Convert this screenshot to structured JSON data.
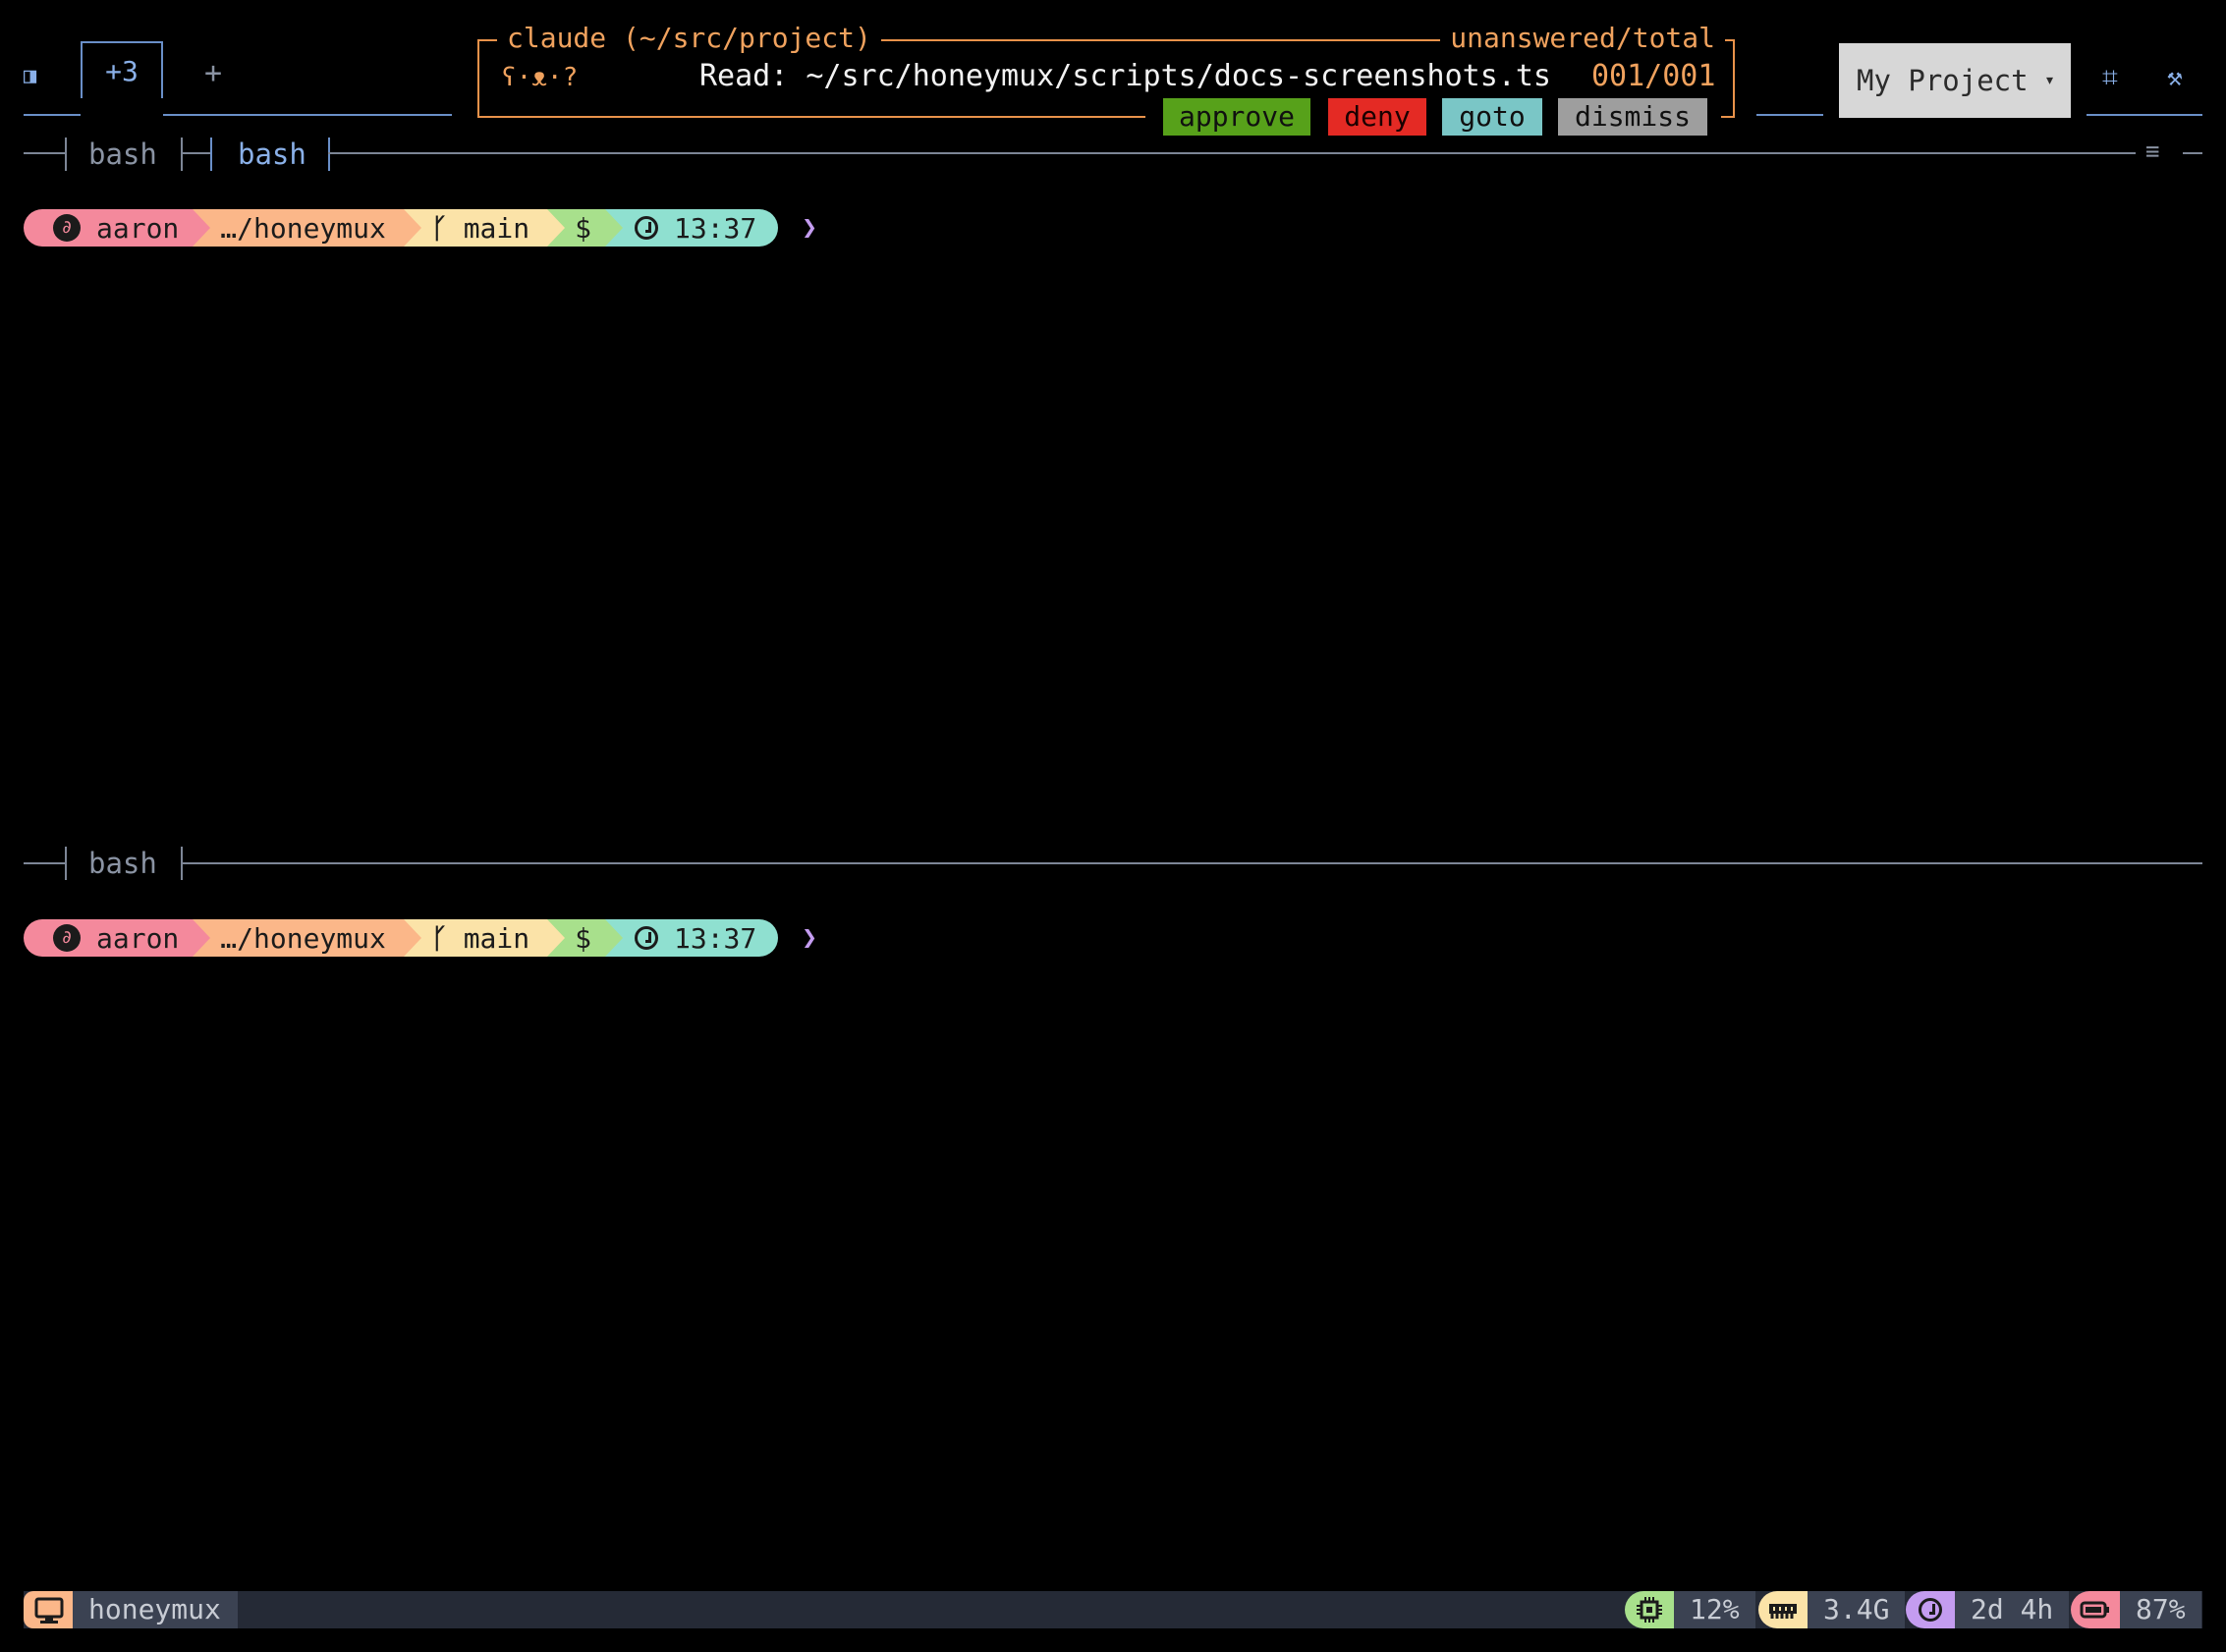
{
  "tabbar": {
    "sidebar_icon": "◨",
    "overflow_label": "+3",
    "add_label": "+"
  },
  "notification": {
    "title": "claude (~/src/project)",
    "counter_label": "unanswered/total",
    "mascot": "ʕ·ᴥ·?",
    "message": "Read: ~/src/honeymux/scripts/docs-screenshots.ts",
    "count": "001/001",
    "actions": {
      "approve": "approve",
      "deny": "deny",
      "goto": "goto",
      "dismiss": "dismiss"
    }
  },
  "project": {
    "label": "My Project",
    "caret": "▾"
  },
  "toolbar": {
    "grid_icon": "⌗",
    "tools_icon": "⚒"
  },
  "panes": {
    "top_tabs": [
      "bash",
      "bash"
    ],
    "bottom_tabs": [
      "bash"
    ],
    "menu_icon": "≡"
  },
  "prompt": {
    "user": "aaron",
    "dir": "…/honeymux",
    "branch": "main",
    "dollar": "$",
    "time": "13:37",
    "caret": "❯",
    "user_glyph": "∂",
    "branch_glyph": "ᚴ"
  },
  "statusbar": {
    "host": "honeymux",
    "cpu": "12%",
    "mem": "3.4G",
    "uptime": "2d 4h",
    "battery": "87%",
    "colors": {
      "cpu": "#a8e08c",
      "mem": "#fbe3a8",
      "uptime": "#c49cf0",
      "battery": "#f4899c"
    }
  }
}
